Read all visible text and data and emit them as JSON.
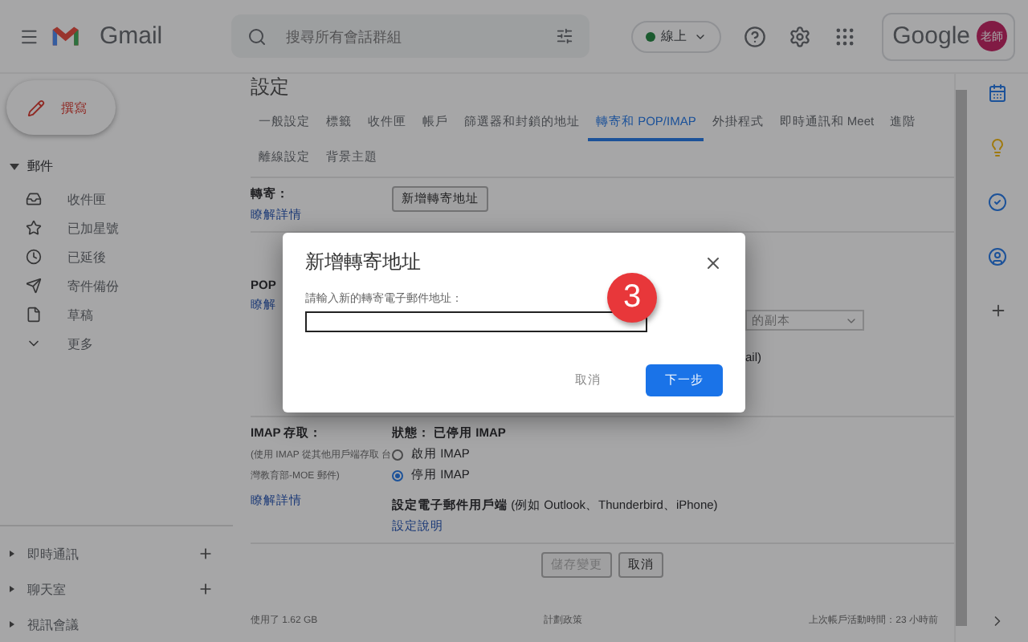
{
  "topbar": {
    "logo": "Gmail",
    "search": {
      "placeholder": "搜尋所有會話群組"
    },
    "status": "線上",
    "account": {
      "brand": "Google",
      "avatar": "老師"
    }
  },
  "sidebar": {
    "compose": "撰寫",
    "section": "郵件",
    "items": [
      {
        "label": "收件匣"
      },
      {
        "label": "已加星號"
      },
      {
        "label": "已延後"
      },
      {
        "label": "寄件備份"
      },
      {
        "label": "草稿"
      },
      {
        "label": "更多"
      }
    ],
    "bottom": [
      {
        "label": "即時通訊",
        "add": true
      },
      {
        "label": "聊天室",
        "add": true
      },
      {
        "label": "視訊會議",
        "add": false
      }
    ]
  },
  "settings": {
    "title": "設定",
    "tabs": [
      {
        "label": "一般設定",
        "selected": false
      },
      {
        "label": "標籤",
        "selected": false
      },
      {
        "label": "收件匣",
        "selected": false
      },
      {
        "label": "帳戶",
        "selected": false
      },
      {
        "label": "篩選器和封鎖的地址",
        "selected": false
      },
      {
        "label": "轉寄和 POP/IMAP",
        "selected": true
      },
      {
        "label": "外掛程式",
        "selected": false
      },
      {
        "label": "即時通訊和 Meet",
        "selected": false
      },
      {
        "label": "進階",
        "selected": false
      },
      {
        "label": "離線設定",
        "selected": false
      },
      {
        "label": "背景主題",
        "selected": false
      }
    ],
    "forwarding": {
      "label": "轉寄：",
      "link": "瞭解詳情",
      "button": "新增轉寄地址"
    },
    "pop": {
      "label": "POP",
      "link": "瞭解",
      "select": "的副本",
      "fragment": "ail)"
    },
    "imap": {
      "label": "IMAP 存取：",
      "note": "(使用 IMAP 從其他用戶端存取 台灣教育部-MOE 郵件)",
      "link": "瞭解詳情",
      "status": "狀態： 已停用 IMAP",
      "options": [
        {
          "label": "啟用 IMAP",
          "selected": false
        },
        {
          "label": "停用 IMAP",
          "selected": true
        }
      ],
      "client": "**設定電子郵件用戶端** (例如 Outlook、Thunderbird、iPhone)",
      "help": "設定說明"
    },
    "buttons": [
      {
        "label": "儲存變更",
        "disabled": true
      },
      {
        "label": "取消",
        "disabled": false
      }
    ],
    "footer": {
      "usage": "使用了 1.62 GB",
      "policy": "計劃政策",
      "activity": "上次帳戶活動時間：23 小時前"
    }
  },
  "dialog": {
    "title": "新增轉寄地址",
    "prompt": "請輸入新的轉寄電子郵件地址：",
    "buttons": [
      {
        "label": "取消",
        "kind": "text"
      },
      {
        "label": "下一步",
        "kind": "primary"
      }
    ]
  },
  "step_badge": "3"
}
